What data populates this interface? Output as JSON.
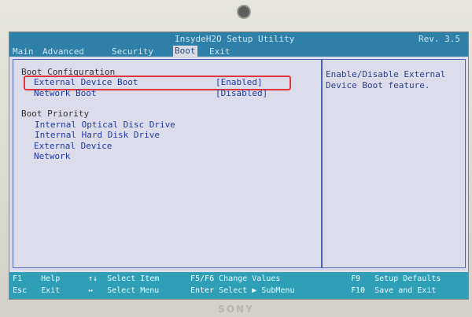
{
  "bios": {
    "title": "InsydeH2O Setup Utility",
    "revision": "Rev. 3.5",
    "tabs": [
      "Main",
      "Advanced",
      "Security",
      "Boot",
      "Exit"
    ],
    "active_tab": "Boot"
  },
  "main": {
    "section1_heading": "Boot Configuration",
    "options": [
      {
        "label": "External Device Boot",
        "value": "[Enabled]",
        "selected": true
      },
      {
        "label": "Network Boot",
        "value": "[Disabled]",
        "selected": false
      }
    ],
    "section2_heading": "Boot Priority",
    "priority": [
      "Internal Optical Disc Drive",
      "Internal Hard Disk Drive",
      "External Device",
      "Network"
    ]
  },
  "help": {
    "text": "Enable/Disable External Device Boot feature."
  },
  "footer": {
    "left_col": [
      {
        "key": "F1",
        "desc": "Help"
      },
      {
        "key": "Esc",
        "desc": "Exit"
      }
    ],
    "mid_col": [
      {
        "key": "↑↓",
        "desc": "Select Item"
      },
      {
        "key": "↔",
        "desc": "Select Menu"
      }
    ],
    "mid2_col": [
      {
        "key": "F5/F6",
        "desc": "Change Values"
      },
      {
        "key": "Enter",
        "desc": "Select ▶ SubMenu"
      }
    ],
    "right_col": [
      {
        "key": "F9",
        "desc": "Setup Defaults"
      },
      {
        "key": "F10",
        "desc": "Save and Exit"
      }
    ]
  },
  "laptop_brand": "SONY",
  "colors": {
    "title_bar": "#2f80a9",
    "screen_bg": "#dcdcea",
    "item_text": "#1f3aa6",
    "footer_bg": "#2f9fb8",
    "highlight_box": "#e0383e"
  }
}
